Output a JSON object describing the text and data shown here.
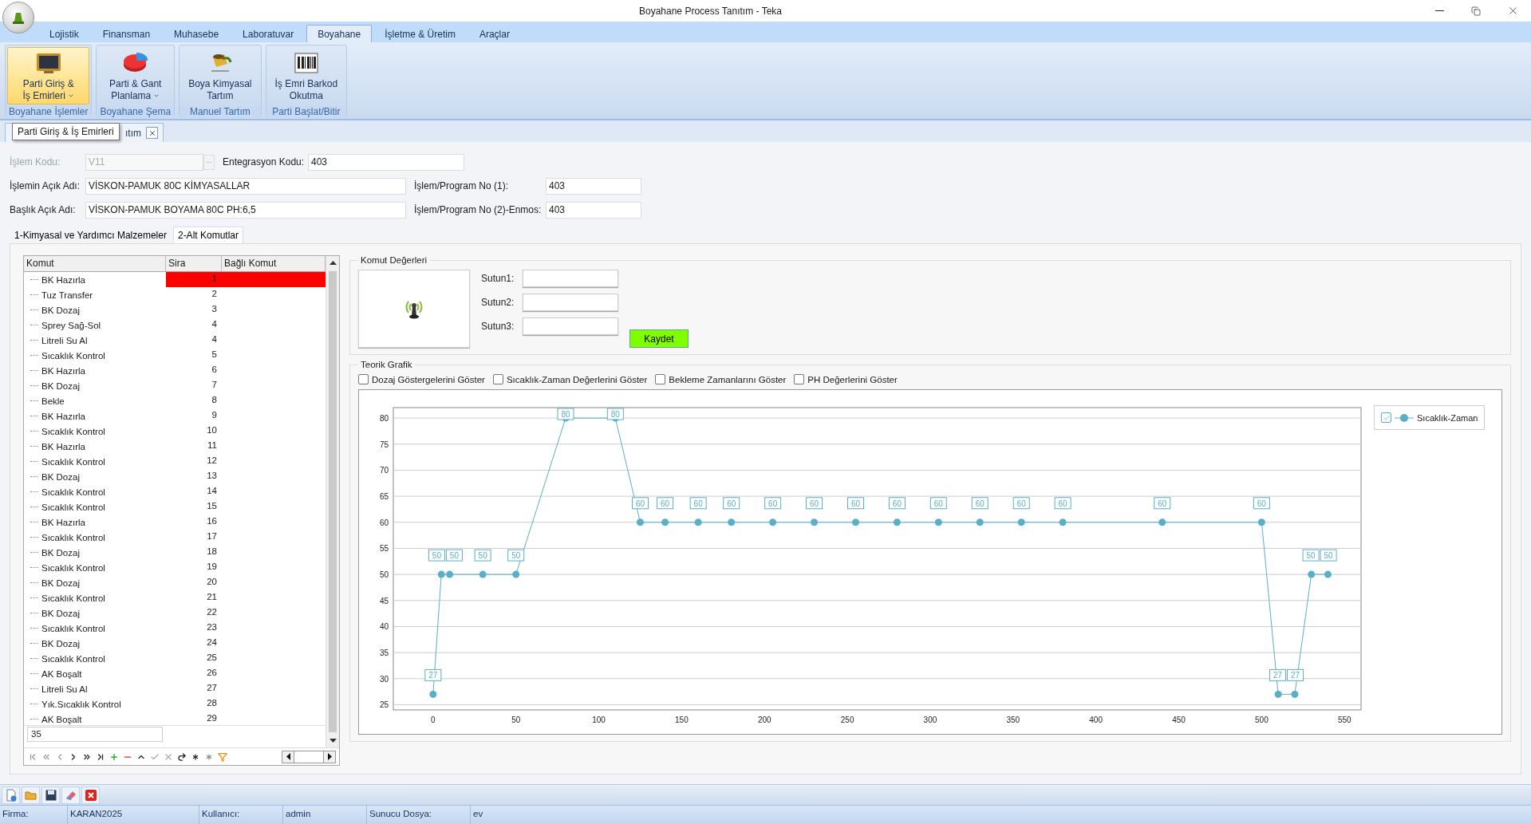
{
  "window": {
    "title": "Boyahane Process Tanıtım - Teka"
  },
  "ribbon_tabs": [
    {
      "label": "Lojistik",
      "selected": false
    },
    {
      "label": "Finansman",
      "selected": false
    },
    {
      "label": "Muhasebe",
      "selected": false
    },
    {
      "label": "Laboratuvar",
      "selected": false
    },
    {
      "label": "Boyahane",
      "selected": true
    },
    {
      "label": "İşletme & Üretim",
      "selected": false
    },
    {
      "label": "Araçlar",
      "selected": false
    }
  ],
  "ribbon_groups": [
    {
      "caption": "Boyahane İşlemler",
      "button": {
        "kind": "monitor",
        "lines": [
          "Parti Giriş &",
          "İş Emirleri"
        ],
        "dropdown": true,
        "selected": true
      }
    },
    {
      "caption": "Boyahane Şema",
      "button": {
        "kind": "pie",
        "lines": [
          "Parti & Gant",
          "Planlama"
        ],
        "dropdown": true,
        "selected": false
      }
    },
    {
      "caption": "Manuel Tartım",
      "button": {
        "kind": "paint",
        "lines": [
          "Boya Kimyasal",
          "Tartım"
        ],
        "dropdown": false,
        "selected": false
      }
    },
    {
      "caption": "Parti Başlat/Bitir",
      "button": {
        "kind": "barcode",
        "lines": [
          "İş Emri Barkod",
          "Okutma"
        ],
        "dropdown": false,
        "selected": false
      }
    }
  ],
  "document_tab": {
    "label": "ıtım"
  },
  "tooltip": "Parti Giriş & İş Emirleri",
  "form": {
    "code": {
      "label": "İşlem Kodu:",
      "value": "V11",
      "disabled": true,
      "browse": "···"
    },
    "integration": {
      "label": "Entegrasyon Kodu:",
      "value": "403"
    },
    "rows": [
      [
        {
          "label": "İşlemin Açık Adı:",
          "value": "VİSKON-PAMUK 80C KİMYASALLAR"
        },
        {
          "label": "İşlem/Program No (1):",
          "value": "403"
        }
      ],
      [
        {
          "label": "Başlık Açık Adı:",
          "value": "VİSKON-PAMUK BOYAMA 80C PH:6,5"
        },
        {
          "label": "İşlem/Program No (2)-Enmos:",
          "value": "403"
        }
      ]
    ]
  },
  "sub_tabs": [
    {
      "label": "1-Kimyasal ve Yardımcı Malzemeler",
      "selected": false
    },
    {
      "label": "2-Alt Komutlar",
      "selected": true
    }
  ],
  "grid": {
    "columns": [
      "Komut",
      "Sira",
      "Bağlı Komut"
    ],
    "rows": [
      {
        "komut": "BK Hazırla",
        "sira": "1",
        "selected": true
      },
      {
        "komut": "Tuz Transfer",
        "sira": "2",
        "selected": false
      },
      {
        "komut": "BK Dozaj",
        "sira": "3",
        "selected": false
      },
      {
        "komut": "Sprey Sağ-Sol",
        "sira": "4",
        "selected": false
      },
      {
        "komut": "Litreli Su Al",
        "sira": "4",
        "selected": false
      },
      {
        "komut": "Sıcaklık Kontrol",
        "sira": "5",
        "selected": false
      },
      {
        "komut": "BK Hazırla",
        "sira": "6",
        "selected": false
      },
      {
        "komut": "BK Dozaj",
        "sira": "7",
        "selected": false
      },
      {
        "komut": "Bekle",
        "sira": "8",
        "selected": false
      },
      {
        "komut": "BK Hazırla",
        "sira": "9",
        "selected": false
      },
      {
        "komut": "Sıcaklık Kontrol",
        "sira": "10",
        "selected": false
      },
      {
        "komut": "BK Hazırla",
        "sira": "11",
        "selected": false
      },
      {
        "komut": "Sıcaklık Kontrol",
        "sira": "12",
        "selected": false
      },
      {
        "komut": "BK Dozaj",
        "sira": "13",
        "selected": false
      },
      {
        "komut": "Sıcaklık Kontrol",
        "sira": "14",
        "selected": false
      },
      {
        "komut": "Sıcaklık Kontrol",
        "sira": "15",
        "selected": false
      },
      {
        "komut": "BK Hazırla",
        "sira": "16",
        "selected": false
      },
      {
        "komut": "Sıcaklık Kontrol",
        "sira": "17",
        "selected": false
      },
      {
        "komut": "BK Dozaj",
        "sira": "18",
        "selected": false
      },
      {
        "komut": "Sıcaklık Kontrol",
        "sira": "19",
        "selected": false
      },
      {
        "komut": "BK Dozaj",
        "sira": "20",
        "selected": false
      },
      {
        "komut": "Sıcaklık Kontrol",
        "sira": "21",
        "selected": false
      },
      {
        "komut": "BK Dozaj",
        "sira": "22",
        "selected": false
      },
      {
        "komut": "Sıcaklık Kontrol",
        "sira": "23",
        "selected": false
      },
      {
        "komut": "BK Dozaj",
        "sira": "24",
        "selected": false
      },
      {
        "komut": "Sıcaklık Kontrol",
        "sira": "25",
        "selected": false
      },
      {
        "komut": "AK Boşalt",
        "sira": "26",
        "selected": false
      },
      {
        "komut": "Litreli Su Al",
        "sira": "27",
        "selected": false
      },
      {
        "komut": "Yık.Sıcaklık Kontrol",
        "sira": "28",
        "selected": false
      },
      {
        "komut": "AK Boşalt",
        "sira": "29",
        "selected": false
      }
    ],
    "footer_value": "35"
  },
  "command_values": {
    "title": "Komut Değerleri",
    "fields": [
      {
        "label": "Sutun1:"
      },
      {
        "label": "Sutun2:"
      },
      {
        "label": "Sutun3:"
      }
    ],
    "save_button": "Kaydet"
  },
  "theoretical_chart": {
    "title": "Teorik Grafik",
    "checkboxes": [
      {
        "label": "Dozaj Göstergelerini Göster",
        "checked": false
      },
      {
        "label": "Sıcaklık-Zaman Değerlerini Göster",
        "checked": false
      },
      {
        "label": "Bekleme Zamanlarını Göster",
        "checked": false
      },
      {
        "label": "PH Değerlerini Göster",
        "checked": false
      }
    ],
    "legend": {
      "checked": true
    },
    "chart_data": {
      "type": "line",
      "x": [
        0,
        5,
        10,
        30,
        50,
        80,
        110,
        125,
        140,
        160,
        180,
        205,
        230,
        255,
        280,
        305,
        330,
        355,
        380,
        440,
        500,
        510,
        520,
        530,
        540
      ],
      "series": [
        {
          "name": "Sıcaklık-Zaman",
          "color": "#5aafc8",
          "marker": "circle",
          "values": [
            27,
            50,
            50,
            50,
            50,
            80,
            80,
            60,
            60,
            60,
            60,
            60,
            60,
            60,
            60,
            60,
            60,
            60,
            60,
            60,
            60,
            27,
            27,
            50,
            50
          ]
        }
      ],
      "grid": true,
      "xlim": [
        -24,
        560
      ],
      "ylim": [
        24,
        82
      ],
      "xticks": [
        0,
        50,
        100,
        150,
        200,
        250,
        300,
        350,
        400,
        450,
        500,
        550
      ],
      "yticks": [
        25,
        30,
        35,
        40,
        45,
        50,
        55,
        60,
        65,
        70,
        75,
        80
      ],
      "data_labels": true
    }
  },
  "status_bar": [
    {
      "label": "Firma:",
      "value": "KARAN2025"
    },
    {
      "label": "Kullanıcı:",
      "value": "admin"
    },
    {
      "label": "Sunucu Dosya:",
      "value": "ev"
    }
  ]
}
